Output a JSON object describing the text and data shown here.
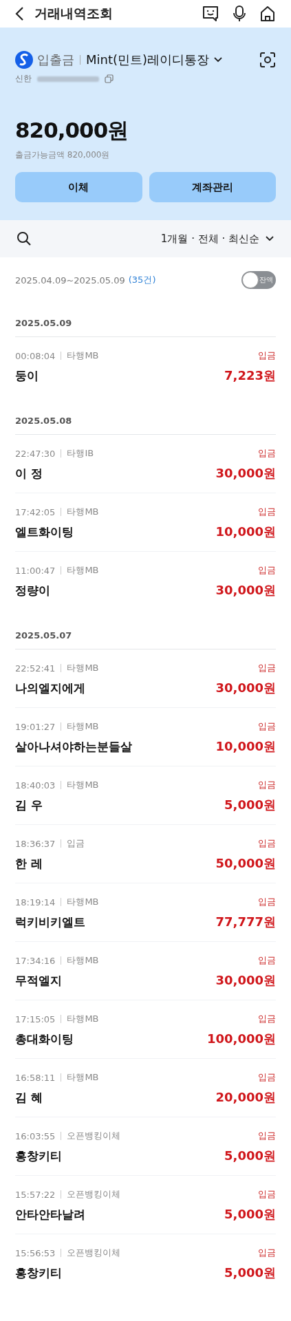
{
  "header": {
    "title": "거래내역조회"
  },
  "account": {
    "type": "입출금",
    "name": "Mint(민트)레이디통장",
    "bank": "신한",
    "balance": "820,000원",
    "available_label": "출금가능금액",
    "available": "820,000원",
    "buttons": [
      "이체",
      "계좌관리"
    ]
  },
  "filter": {
    "summary": "1개월 · 전체 · 최신순"
  },
  "range": {
    "period": "2025.04.09~2025.05.09",
    "count": "(35건)",
    "balance_toggle": {
      "label": "잔액",
      "on": false
    }
  },
  "groups": [
    {
      "date": "2025.05.09",
      "items": [
        {
          "time": "00:08:04",
          "channel": "타행MB",
          "name": "둥이",
          "type": "입금",
          "amount": "7,223원"
        }
      ]
    },
    {
      "date": "2025.05.08",
      "items": [
        {
          "time": "22:47:30",
          "channel": "타행IB",
          "name": "이 정",
          "type": "입금",
          "amount": "30,000원"
        },
        {
          "time": "17:42:05",
          "channel": "타행MB",
          "name": "엘트화이팅",
          "type": "입금",
          "amount": "10,000원"
        },
        {
          "time": "11:00:47",
          "channel": "타행MB",
          "name": "정량이",
          "type": "입금",
          "amount": "30,000원"
        }
      ]
    },
    {
      "date": "2025.05.07",
      "items": [
        {
          "time": "22:52:41",
          "channel": "타행MB",
          "name": "나의엘지에게",
          "type": "입금",
          "amount": "30,000원"
        },
        {
          "time": "19:01:27",
          "channel": "타행MB",
          "name": "살아나셔야하는분들살",
          "type": "입금",
          "amount": "10,000원"
        },
        {
          "time": "18:40:03",
          "channel": "타행MB",
          "name": "김 우",
          "type": "입금",
          "amount": "5,000원"
        },
        {
          "time": "18:36:37",
          "channel": "입금",
          "name": "한 레",
          "type": "입금",
          "amount": "50,000원"
        },
        {
          "time": "18:19:14",
          "channel": "타행MB",
          "name": "럭키비키엘트",
          "type": "입금",
          "amount": "77,777원"
        },
        {
          "time": "17:34:16",
          "channel": "타행MB",
          "name": "무적엘지",
          "type": "입금",
          "amount": "30,000원"
        },
        {
          "time": "17:15:05",
          "channel": "타행MB",
          "name": "총대화이팅",
          "type": "입금",
          "amount": "100,000원"
        },
        {
          "time": "16:58:11",
          "channel": "타행MB",
          "name": "김 혜",
          "type": "입금",
          "amount": "20,000원"
        },
        {
          "time": "16:03:55",
          "channel": "오픈뱅킹이체",
          "name": "홍창키티",
          "type": "입금",
          "amount": "5,000원"
        },
        {
          "time": "15:57:22",
          "channel": "오픈뱅킹이체",
          "name": "안타안타날려",
          "type": "입금",
          "amount": "5,000원"
        },
        {
          "time": "15:56:53",
          "channel": "오픈뱅킹이체",
          "name": "홍창키티",
          "type": "입금",
          "amount": "5,000원"
        }
      ]
    }
  ]
}
